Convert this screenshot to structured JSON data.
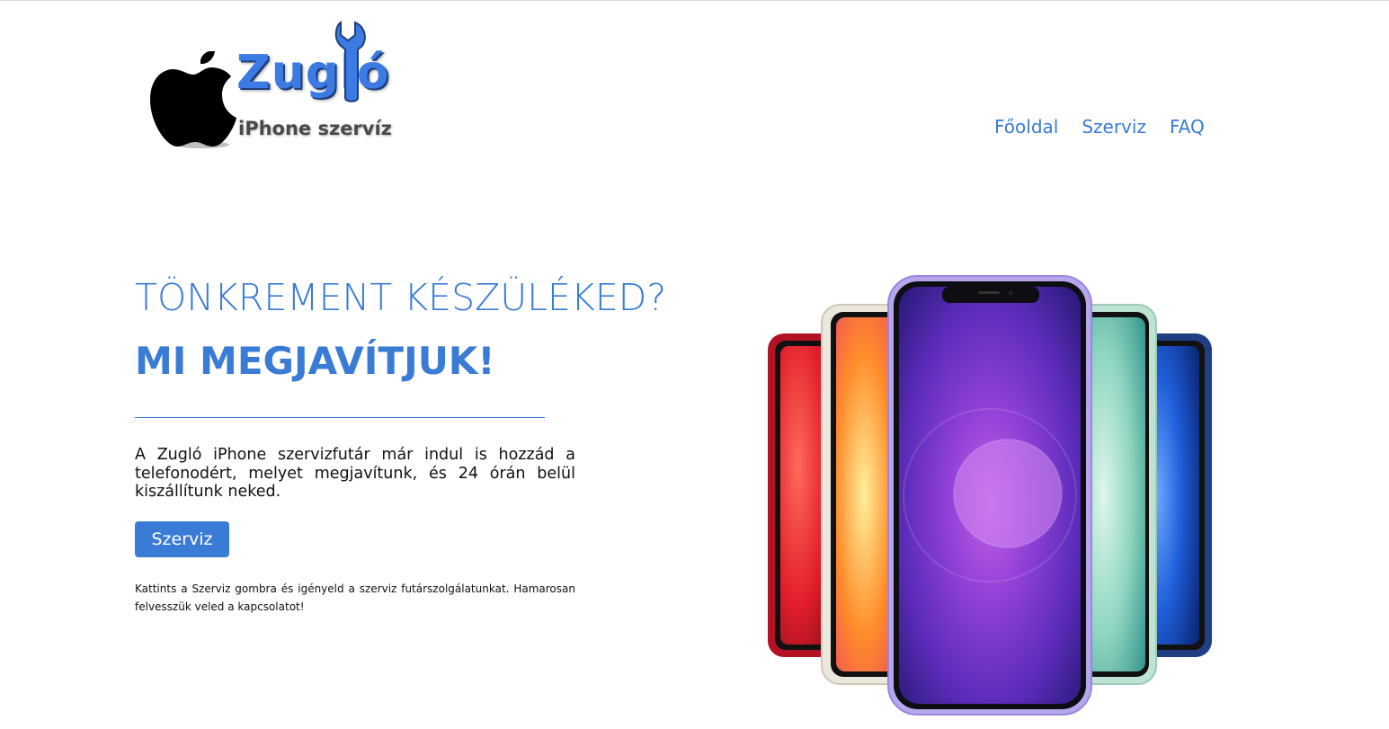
{
  "logo": {
    "title": "Zugló",
    "subtitle": "iPhone szervíz",
    "apple_icon": "apple-icon",
    "wrench_icon": "wrench-icon"
  },
  "nav": {
    "items": [
      {
        "label": "Főoldal"
      },
      {
        "label": "Szerviz"
      },
      {
        "label": "FAQ"
      }
    ]
  },
  "hero": {
    "headline": "TÖNKREMENT KÉSZÜLÉKED?",
    "subheadline": "MI MEGJAVÍTJUK!",
    "description": "A Zugló iPhone szervizfutár már indul is hozzád a telefonodért, melyet megjavítunk, és 24 órán belül kiszállítunk neked.",
    "button_label": "Szerviz",
    "note": "Kattints a Szerviz gombra és igényeld a szerviz futárszolgálatunkat. Hamarosan felvesszük veled a kapcsolatot!"
  },
  "colors": {
    "accent": "#3a7bd5",
    "text": "#111111",
    "background": "#ffffff"
  },
  "image": {
    "name": "iphone-12-lineup",
    "colors": [
      "#c8102e",
      "#f5f0e6",
      "#7b5fd6",
      "#a8d8c4",
      "#1f4a9a"
    ]
  }
}
